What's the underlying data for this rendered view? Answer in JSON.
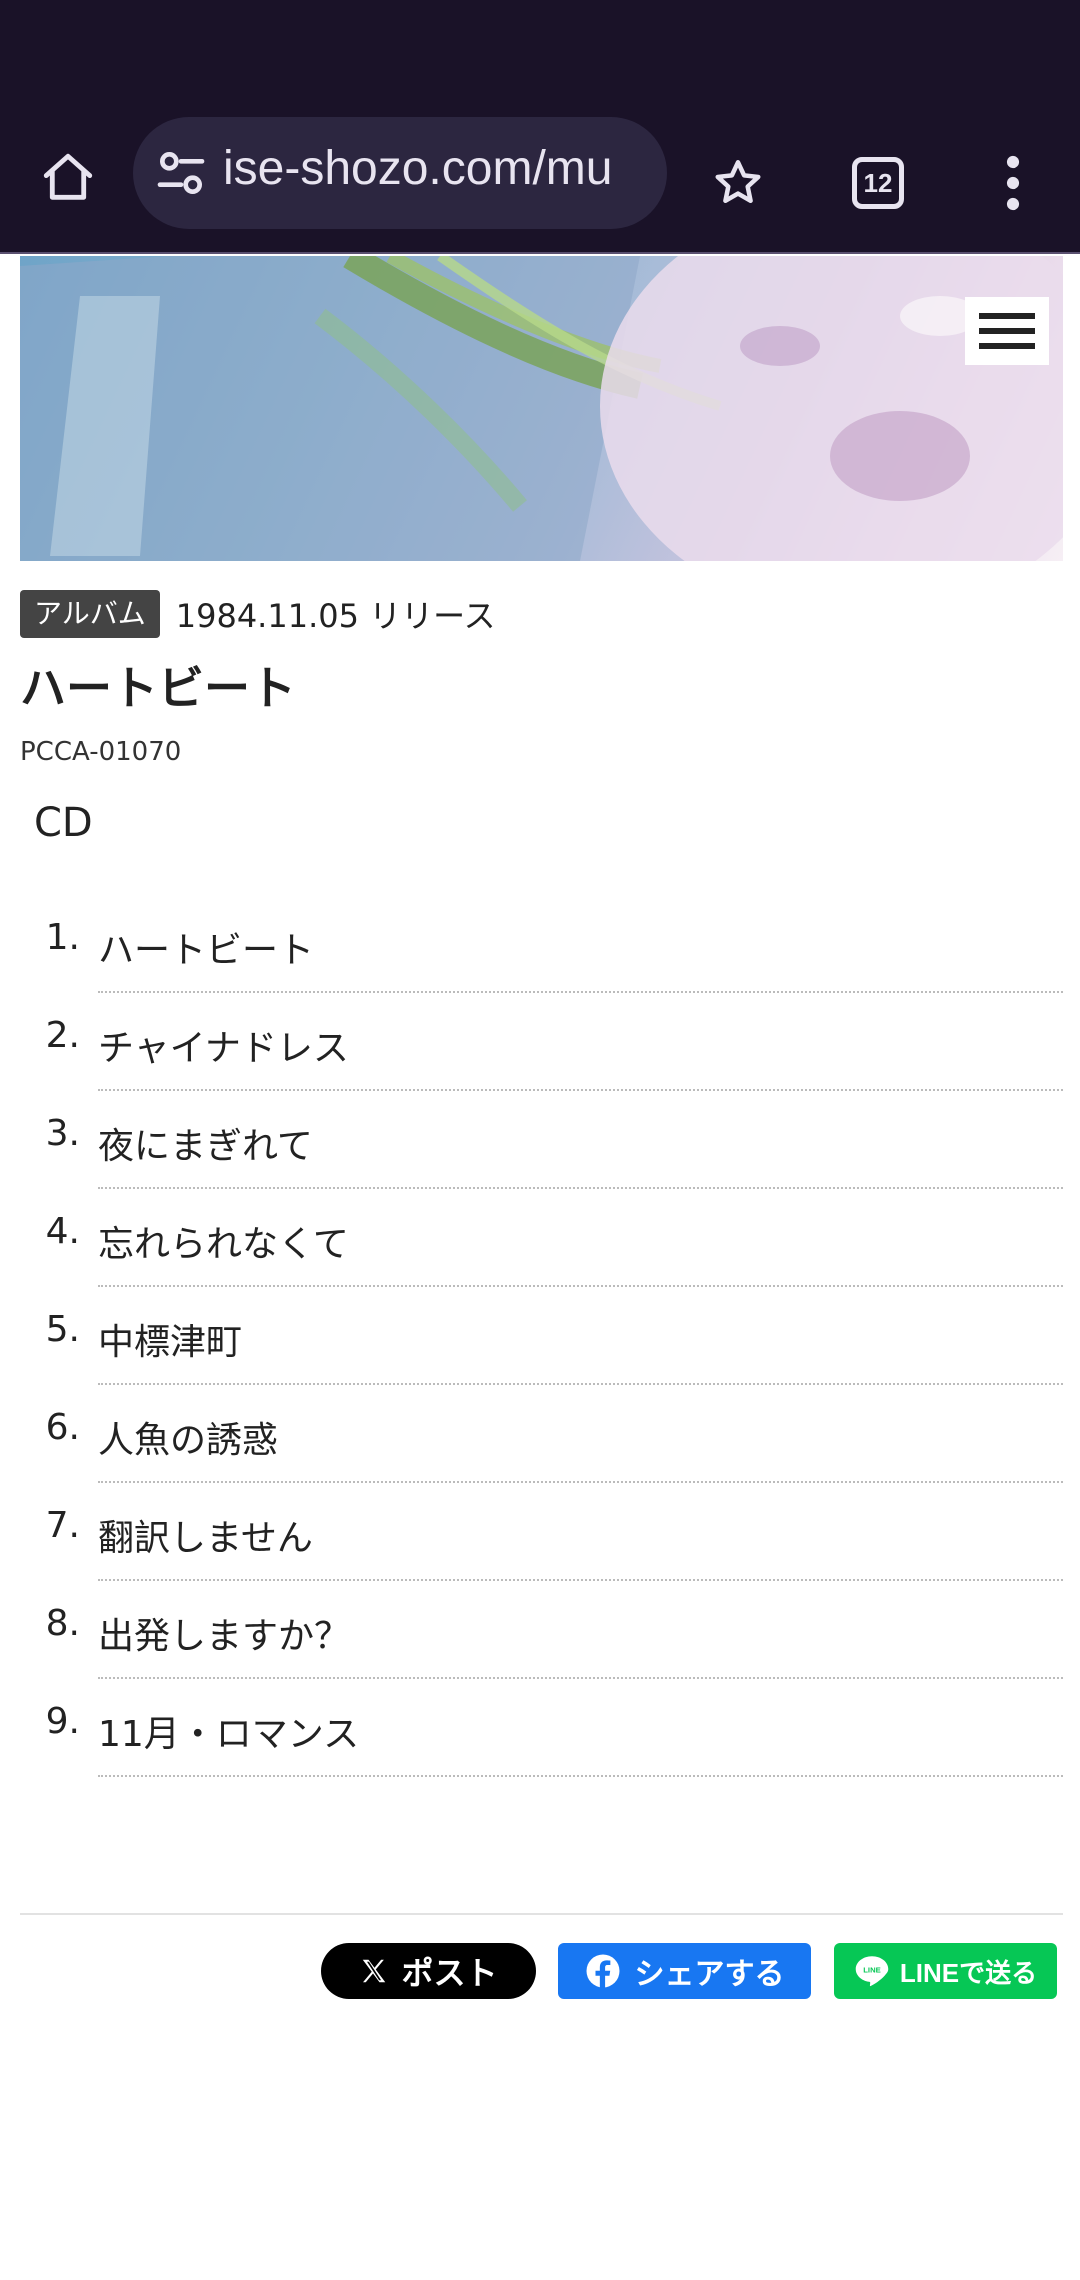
{
  "browser": {
    "url": "ise-shozo.com/mu",
    "tab_count": "12",
    "colors": {
      "chrome_bg": "#1a1228",
      "url_pill_bg": "#2c2640"
    }
  },
  "album": {
    "badge": "アルバム",
    "release": "1984.11.05 リリース",
    "title": "ハートビート",
    "catalog_no": "PCCA-01070",
    "media": "CD"
  },
  "tracks": [
    {
      "num": "1.",
      "title": "ハートビート"
    },
    {
      "num": "2.",
      "title": "チャイナドレス"
    },
    {
      "num": "3.",
      "title": "夜にまぎれて"
    },
    {
      "num": "4.",
      "title": "忘れられなくて"
    },
    {
      "num": "5.",
      "title": "中標津町"
    },
    {
      "num": "6.",
      "title": "人魚の誘惑"
    },
    {
      "num": "7.",
      "title": "翻訳しません"
    },
    {
      "num": "8.",
      "title": "出発しますか？"
    },
    {
      "num": "9.",
      "title": "11月・ロマンス"
    }
  ],
  "share": {
    "x_label": "ポスト",
    "facebook_label": "シェアする",
    "line_label": "LINEで送る",
    "colors": {
      "x": "#000000",
      "facebook": "#1877f2",
      "line": "#06c755"
    }
  },
  "icons": [
    "home-icon",
    "site-settings-icon",
    "star-icon",
    "tabs-icon",
    "more-vert-icon",
    "hamburger-menu-icon",
    "x-logo-icon",
    "facebook-logo-icon",
    "line-logo-icon"
  ]
}
